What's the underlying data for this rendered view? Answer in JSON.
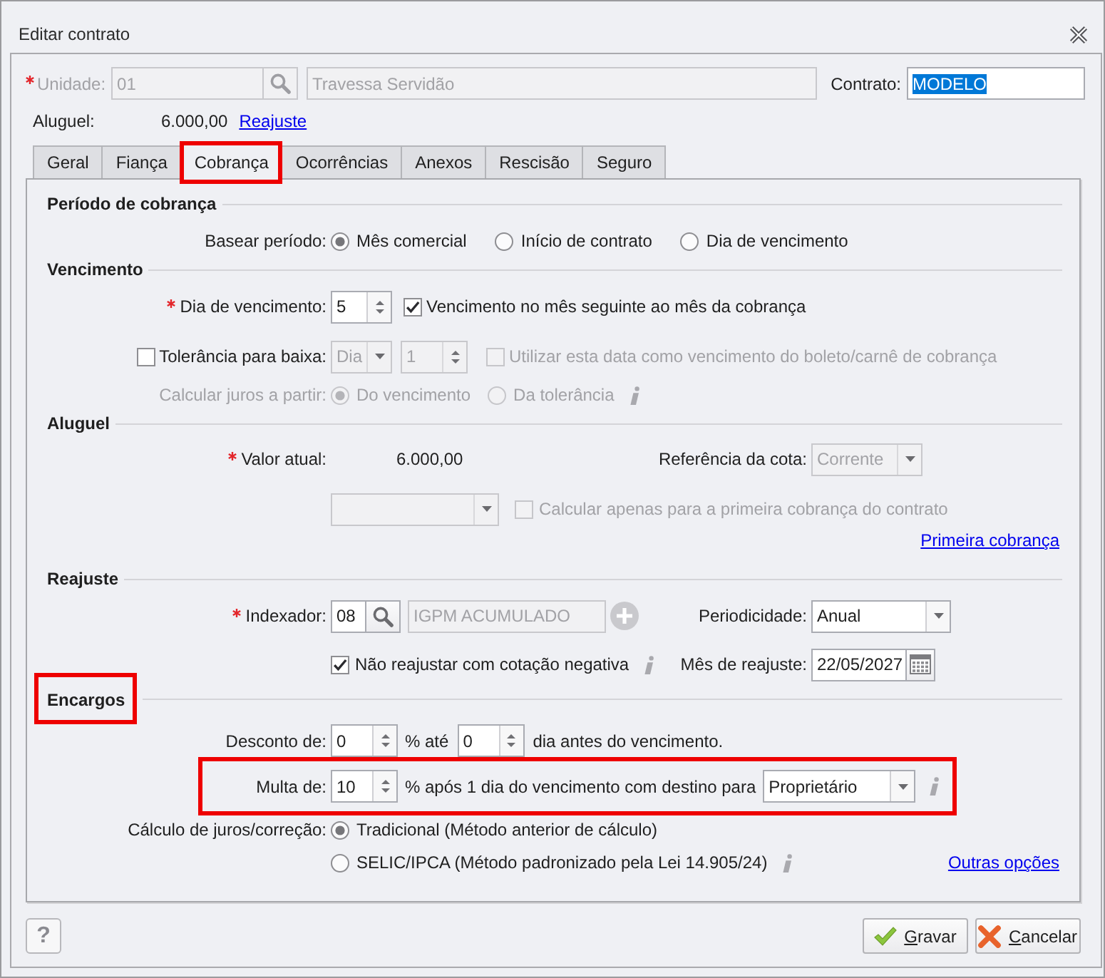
{
  "window": {
    "title": "Editar contrato"
  },
  "header": {
    "unit": {
      "label": "Unidade:",
      "required": true,
      "disabled": true,
      "code": "01",
      "name": "Travessa Servidão"
    },
    "contract": {
      "label": "Contrato:",
      "value": "MODELO",
      "text_selected": true
    },
    "rent": {
      "label": "Aluguel:",
      "value": "6.000,00",
      "link": "Reajuste"
    }
  },
  "tabs": [
    {
      "label": "Geral",
      "selected": false,
      "highlighted": false
    },
    {
      "label": "Fiança",
      "selected": false,
      "highlighted": false
    },
    {
      "label": "Cobrança",
      "selected": true,
      "highlighted": true
    },
    {
      "label": "Ocorrências",
      "selected": false,
      "highlighted": false
    },
    {
      "label": "Anexos",
      "selected": false,
      "highlighted": false
    },
    {
      "label": "Rescisão",
      "selected": false,
      "highlighted": false
    },
    {
      "label": "Seguro",
      "selected": false,
      "highlighted": false
    }
  ],
  "billing_period": {
    "heading": "Período de cobrança",
    "label": "Basear período:",
    "options": [
      {
        "label": "Mês comercial",
        "selected": true
      },
      {
        "label": "Início de contrato",
        "selected": false
      },
      {
        "label": "Dia de vencimento",
        "selected": false
      }
    ]
  },
  "due_date": {
    "heading": "Vencimento",
    "due_day": {
      "label": "Dia de vencimento:",
      "required": true,
      "value": "5"
    },
    "next_month": {
      "label": "Vencimento no mês seguinte ao mês da cobrança",
      "checked": true
    },
    "tolerance": {
      "label": "Tolerância para baixa:",
      "checked": false,
      "disabled": true,
      "unit": "Dia",
      "days": "1"
    },
    "use_as_due": {
      "label": "Utilizar esta data como vencimento do boleto/carnê de cobrança",
      "checked": false,
      "disabled": true
    },
    "interest_from": {
      "label": "Calcular juros a partir:",
      "disabled": true,
      "options": [
        {
          "label": "Do vencimento",
          "selected": true
        },
        {
          "label": "Da tolerância",
          "selected": false
        }
      ]
    }
  },
  "rent": {
    "heading": "Aluguel",
    "current_value": {
      "label": "Valor atual:",
      "required": true,
      "value": "6.000,00"
    },
    "quota_reference": {
      "label": "Referência da cota:",
      "value": "Corrente",
      "disabled": true
    },
    "unlabeled_combo": {
      "disabled": true
    },
    "first_only": {
      "label": "Calcular apenas para a primeira cobrança do contrato",
      "checked": false,
      "disabled": true
    },
    "link": "Primeira cobrança"
  },
  "adjustment": {
    "heading": "Reajuste",
    "indexer": {
      "label": "Indexador:",
      "required": true,
      "code": "08",
      "name": "IGPM ACUMULADO",
      "name_disabled": true
    },
    "periodicity": {
      "label": "Periodicidade:",
      "value": "Anual"
    },
    "skip_negative": {
      "label": "Não reajustar com cotação negativa",
      "checked": true
    },
    "adjust_month": {
      "label": "Mês de reajuste:",
      "value": "22/05/2027"
    }
  },
  "charges": {
    "heading": "Encargos",
    "highlighted": true,
    "discount": {
      "label": "Desconto de:",
      "value": "0",
      "middle": "% até",
      "days": "0",
      "suffix": "dia antes do vencimento."
    },
    "fine": {
      "label": "Multa de:",
      "value": "10",
      "suffix": "% após 1 dia do vencimento com destino para",
      "destination": "Proprietário",
      "highlighted": true
    },
    "interest_method": {
      "label": "Cálculo de juros/correção:",
      "options": [
        {
          "label": "Tradicional (Método anterior de cálculo)",
          "selected": true
        },
        {
          "label": "SELIC/IPCA (Método padronizado pela Lei 14.905/24)",
          "selected": false
        }
      ]
    },
    "link": "Outras opções"
  },
  "footer": {
    "help": "?",
    "buttons": [
      {
        "kind": "save",
        "label": "Gravar",
        "access_key": true
      },
      {
        "kind": "cancel",
        "label": "Cancelar",
        "access_key": true
      }
    ]
  }
}
